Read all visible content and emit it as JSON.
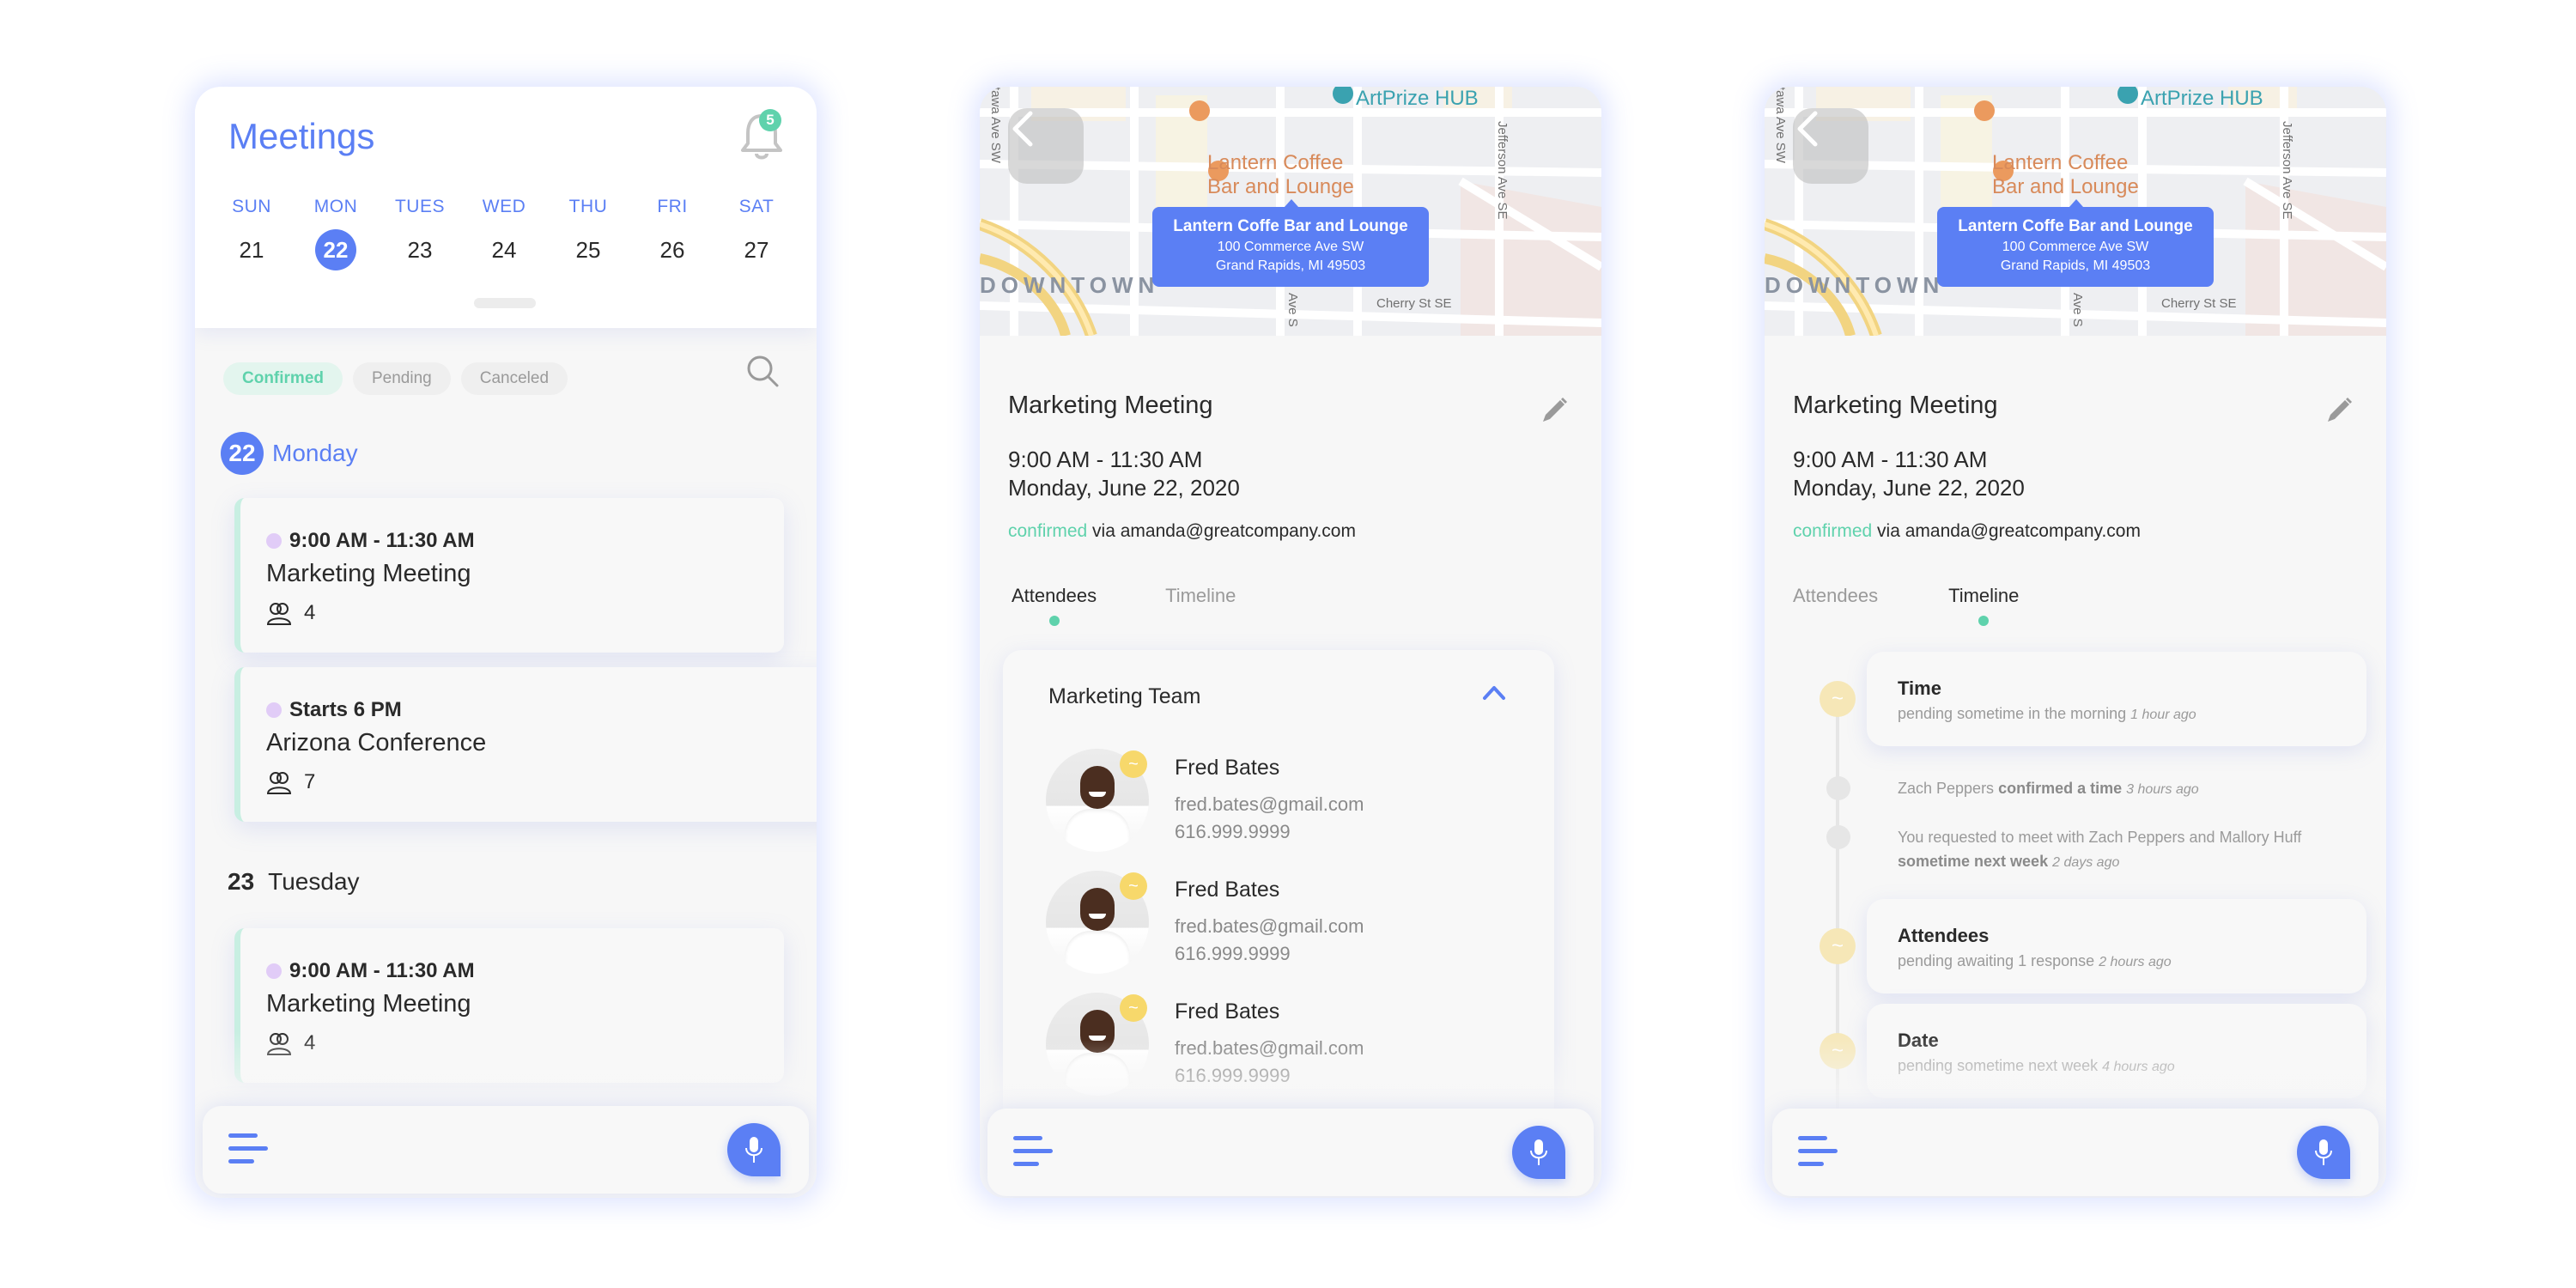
{
  "colors": {
    "accent": "#5b7ff4",
    "confirmed": "#5fd2ac",
    "pending": "#f7d86b",
    "event_dot": "#e1ccf7",
    "card_stripe": "#c8efe2"
  },
  "screen1": {
    "title": "Meetings",
    "notification_count": "5",
    "week": [
      {
        "name": "SUN",
        "num": "21",
        "active": false
      },
      {
        "name": "MON",
        "num": "22",
        "active": true
      },
      {
        "name": "TUES",
        "num": "23",
        "active": false
      },
      {
        "name": "WED",
        "num": "24",
        "active": false
      },
      {
        "name": "THU",
        "num": "25",
        "active": false
      },
      {
        "name": "FRI",
        "num": "26",
        "active": false
      },
      {
        "name": "SAT",
        "num": "27",
        "active": false
      }
    ],
    "filters": [
      {
        "label": "Confirmed",
        "active": true
      },
      {
        "label": "Pending",
        "active": false
      },
      {
        "label": "Canceled",
        "active": false
      }
    ],
    "days": [
      {
        "num": "22",
        "label": "Monday",
        "meetings": [
          {
            "time": "9:00 AM - 11:30 AM",
            "title": "Marketing Meeting",
            "attendees": "4"
          },
          {
            "time": "Starts 6 PM",
            "title": "Arizona Conference",
            "attendees": "7"
          }
        ]
      },
      {
        "num": "23",
        "label": "Tuesday",
        "meetings": [
          {
            "time": "9:00 AM - 11:30 AM",
            "title": "Marketing Meeting",
            "attendees": "4"
          }
        ]
      }
    ]
  },
  "map": {
    "poi_artprize": "ArtPrize HUB",
    "poi_lantern_line1": "Lantern Coffee",
    "poi_lantern_line2": "Bar and Lounge",
    "district": "DOWNTOWN",
    "street_cherry": "Cherry St SE",
    "street_jefferson": "Jefferson Ave SE",
    "street_ottawa": "tawa Ave SW",
    "street_ave": "Ave S",
    "tooltip": {
      "name": "Lantern Coffe Bar and Lounge",
      "address1": "100 Commerce Ave SW",
      "address2": "Grand Rapids, MI 49503"
    }
  },
  "detail": {
    "title": "Marketing Meeting",
    "time": "9:00 AM - 11:30 AM",
    "date": "Monday, June 22, 2020",
    "status": "confirmed",
    "via": "via amanda@greatcompany.com",
    "tabs": [
      "Attendees",
      "Timeline"
    ]
  },
  "screen2": {
    "active_tab": "Attendees",
    "team": "Marketing Team",
    "attendees": [
      {
        "name": "Fred Bates",
        "email": "fred.bates@gmail.com",
        "phone": "616.999.9999",
        "status": "pending"
      },
      {
        "name": "Fred Bates",
        "email": "fred.bates@gmail.com",
        "phone": "616.999.9999",
        "status": "pending"
      },
      {
        "name": "Fred Bates",
        "email": "fred.bates@gmail.com",
        "phone": "616.999.9999",
        "status": "pending"
      }
    ]
  },
  "screen3": {
    "active_tab": "Timeline",
    "events": [
      {
        "type": "card",
        "title": "Time",
        "text": "pending sometime in the morning",
        "ago": "1 hour ago"
      },
      {
        "type": "note",
        "pre": "Zach Peppers",
        "bold": "confirmed a time",
        "ago": "3 hours ago"
      },
      {
        "type": "note",
        "pre": "You requested to meet with Zach Peppers and Mallory Huff",
        "bold": "sometime next week",
        "ago": "2 days ago"
      },
      {
        "type": "card",
        "title": "Attendees",
        "text": "pending awaiting 1 response",
        "ago": "2 hours ago"
      },
      {
        "type": "card",
        "title": "Date",
        "text": "pending sometime next week",
        "ago": "4 hours ago"
      }
    ]
  },
  "icons": {
    "pending_glyph": "~"
  }
}
